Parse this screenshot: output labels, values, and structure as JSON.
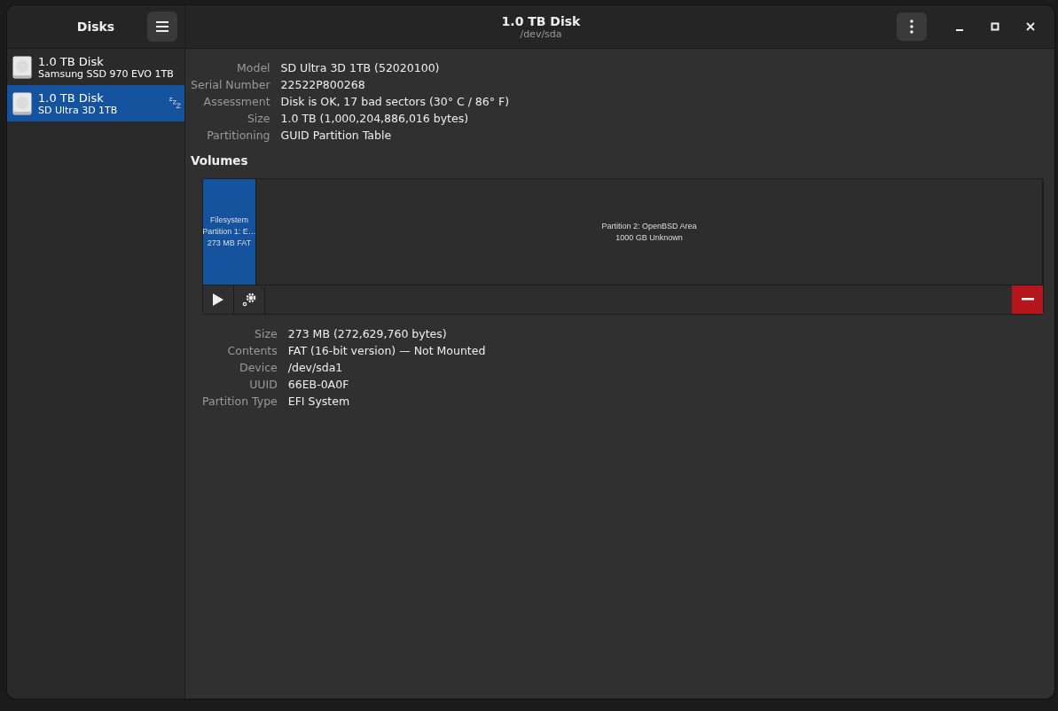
{
  "sidebar": {
    "title": "Disks",
    "items": [
      {
        "name": "1.0 TB Disk",
        "model": "Samsung SSD 970 EVO 1TB",
        "selected": false,
        "standby": false
      },
      {
        "name": "1.0 TB Disk",
        "model": "SD Ultra 3D 1TB",
        "selected": true,
        "standby": true
      }
    ]
  },
  "header": {
    "title": "1.0 TB Disk",
    "subtitle": "/dev/sda"
  },
  "disk_details": [
    {
      "label": "Model",
      "value": "SD Ultra 3D 1TB (52020100)"
    },
    {
      "label": "Serial Number",
      "value": "22522P800268"
    },
    {
      "label": "Assessment",
      "value": "Disk is OK, 17 bad sectors (30° C / 86° F)"
    },
    {
      "label": "Size",
      "value": "1.0 TB (1,000,204,886,016 bytes)"
    },
    {
      "label": "Partitioning",
      "value": "GUID Partition Table"
    }
  ],
  "volumes": {
    "title": "Volumes",
    "partitions": [
      {
        "lines": [
          "Filesystem",
          "Partition 1: E…",
          "273 MB FAT"
        ],
        "selected": true
      },
      {
        "lines": [
          "Partition 2: OpenBSD Area",
          "1000 GB Unknown"
        ],
        "selected": false
      }
    ],
    "details": [
      {
        "label": "Size",
        "value": "273 MB (272,629,760 bytes)"
      },
      {
        "label": "Contents",
        "value": "FAT (16-bit version) — Not Mounted"
      },
      {
        "label": "Device",
        "value": "/dev/sda1"
      },
      {
        "label": "UUID",
        "value": "66EB-0A0F"
      },
      {
        "label": "Partition Type",
        "value": "EFI System"
      }
    ]
  }
}
